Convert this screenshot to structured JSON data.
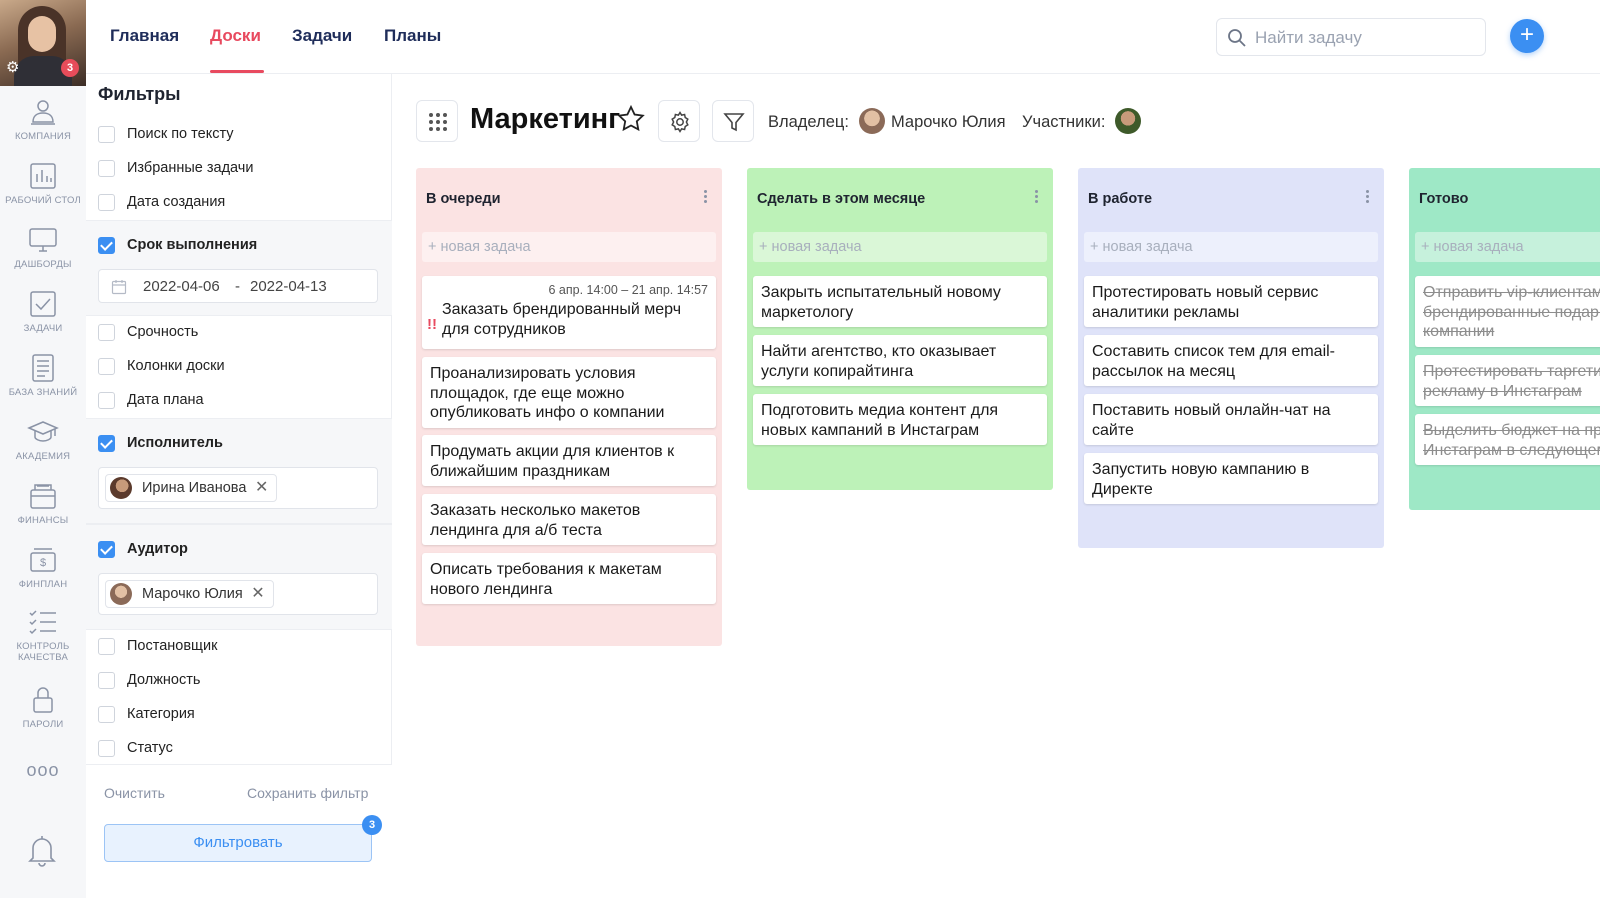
{
  "user": {
    "notifications": "3"
  },
  "rail": {
    "items": [
      {
        "label": "КОМПАНИЯ"
      },
      {
        "label": "РАБОЧИЙ СТОЛ"
      },
      {
        "label": "ДАШБОРДЫ"
      },
      {
        "label": "ЗАДАЧИ"
      },
      {
        "label": "БАЗА ЗНАНИЙ"
      },
      {
        "label": "АКАДЕМИЯ"
      },
      {
        "label": "ФИНАНСЫ"
      },
      {
        "label": "ФИНПЛАН"
      },
      {
        "label": "КОНТРОЛЬ КАЧЕСТВА"
      },
      {
        "label": "ПАРОЛИ"
      }
    ],
    "more": "ooo"
  },
  "nav": {
    "tabs": [
      {
        "label": "Главная"
      },
      {
        "label": "Доски"
      },
      {
        "label": "Задачи"
      },
      {
        "label": "Планы"
      }
    ],
    "active": "Доски"
  },
  "search": {
    "placeholder": "Найти задачу",
    "value": ""
  },
  "add_button": "+",
  "filters": {
    "title": "Фильтры",
    "items": [
      {
        "label": "Поиск по тексту",
        "checked": false
      },
      {
        "label": "Избранные задачи",
        "checked": false
      },
      {
        "label": "Дата создания",
        "checked": false
      },
      {
        "label": "Срок выполнения",
        "checked": true
      },
      {
        "label": "Срочность",
        "checked": false
      },
      {
        "label": "Колонки доски",
        "checked": false
      },
      {
        "label": "Дата плана",
        "checked": false
      },
      {
        "label": "Исполнитель",
        "checked": true
      },
      {
        "label": "Аудитор",
        "checked": true
      },
      {
        "label": "Постановщик",
        "checked": false
      },
      {
        "label": "Должность",
        "checked": false
      },
      {
        "label": "Категория",
        "checked": false
      },
      {
        "label": "Статус",
        "checked": false
      }
    ],
    "date_from": "2022-04-06",
    "date_sep": "-",
    "date_to": "2022-04-13",
    "executor": "Ирина Иванова",
    "auditor": "Марочко Юлия",
    "clear": "Очистить",
    "save": "Сохранить фильтр",
    "apply": "Фильтровать",
    "apply_count": "3"
  },
  "board": {
    "title": "Маркетинг",
    "owner_label": "Владелец:",
    "owner": "Марочко Юлия",
    "members_label": "Участники:"
  },
  "columns": [
    {
      "title": "В очереди",
      "new_task": "+ новая задача",
      "color": "#fbe3e3",
      "new_bg": "#fdf0f0",
      "cards": [
        {
          "due": "6 апр. 14:00 – 21 апр. 14:57",
          "urgent": "!!",
          "text": "Заказать брендированный мерч для сотрудников"
        },
        {
          "text": "Проанализировать условия площадок, где еще можно опубликовать инфо о компании"
        },
        {
          "text": "Продумать акции для клиентов к ближайшим праздникам"
        },
        {
          "text": "Заказать несколько макетов лендинга для а/б теста"
        },
        {
          "text": "Описать требования к макетам нового лендинга"
        }
      ]
    },
    {
      "title": "Сделать в этом месяце",
      "new_task": "+ новая задача",
      "color": "#bdf2b8",
      "new_bg": "#daf7d7",
      "cards": [
        {
          "text": "Закрыть испытательный новому маркетологу"
        },
        {
          "text": "Найти агентство, кто оказывает услуги копирайтинга"
        },
        {
          "text": "Подготовить медиа контент для новых кампаний в Инстаграм"
        }
      ]
    },
    {
      "title": "В работе",
      "new_task": "+ новая задача",
      "color": "#dfe3f9",
      "new_bg": "#edf0fc",
      "cards": [
        {
          "text": "Протестировать новый сервис аналитики рекламы"
        },
        {
          "text": "Составить список тем для email-рассылок на месяц"
        },
        {
          "text": "Поставить новый онлайн-чат на сайте"
        },
        {
          "text": "Запустить новую кампанию в Директе"
        }
      ]
    },
    {
      "title": "Готово",
      "new_task": "+ новая задача",
      "color": "#9ee8c6",
      "new_bg": "#c6f1dc",
      "cards": [
        {
          "text": "Отправить vip-клиентам брендированные подарки от компании"
        },
        {
          "text": "Протестировать таргетированную рекламу в Инстаграм"
        },
        {
          "text": "Выделить бюджет на продвижение в Инстаграм в следующем квартале"
        }
      ]
    }
  ]
}
